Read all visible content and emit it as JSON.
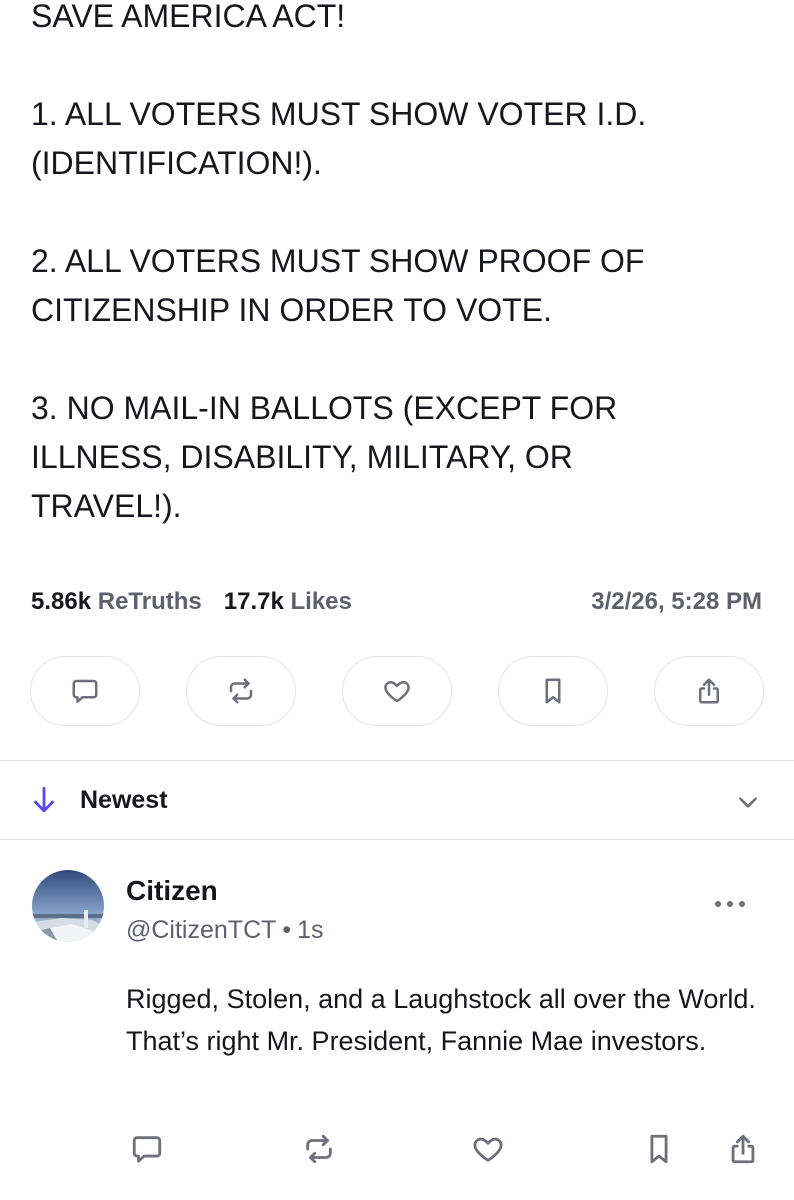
{
  "post": {
    "lines": [
      "SAVE AMERICA ACT!",
      "",
      "1. ALL VOTERS MUST SHOW VOTER I.D.",
      "(IDENTIFICATION!).",
      "",
      "2. ALL VOTERS MUST SHOW PROOF OF",
      "CITIZENSHIP IN ORDER TO VOTE.",
      "",
      "3. NO MAIL-IN BALLOTS (EXCEPT FOR",
      "ILLNESS, DISABILITY, MILITARY, OR",
      "TRAVEL!)."
    ],
    "retruths_count": "5.86k",
    "retruths_label": "ReTruths",
    "likes_count": "17.7k",
    "likes_label": "Likes",
    "timestamp": "3/2/26, 5:28 PM",
    "actions": [
      {
        "name": "reply",
        "icon": "comment-icon"
      },
      {
        "name": "retruth",
        "icon": "repost-icon"
      },
      {
        "name": "like",
        "icon": "heart-icon"
      },
      {
        "name": "bookmark",
        "icon": "bookmark-icon"
      },
      {
        "name": "share",
        "icon": "share-icon"
      }
    ]
  },
  "sort": {
    "label": "Newest",
    "icon": "arrow-down-icon",
    "dropdown_icon": "chevron-down-icon"
  },
  "reply": {
    "name": "Citizen",
    "handle": "@CitizenTCT",
    "separator": "•",
    "time": "1s",
    "text": "Rigged, Stolen, and a Laughstock all over the World. That’s right Mr. President, Fannie Mae investors."
  },
  "colors": {
    "accent": "#5448ee",
    "muted_text": "#5f5f6e",
    "icon_gray": "#6f6f7e",
    "border": "#e3e3ea"
  }
}
